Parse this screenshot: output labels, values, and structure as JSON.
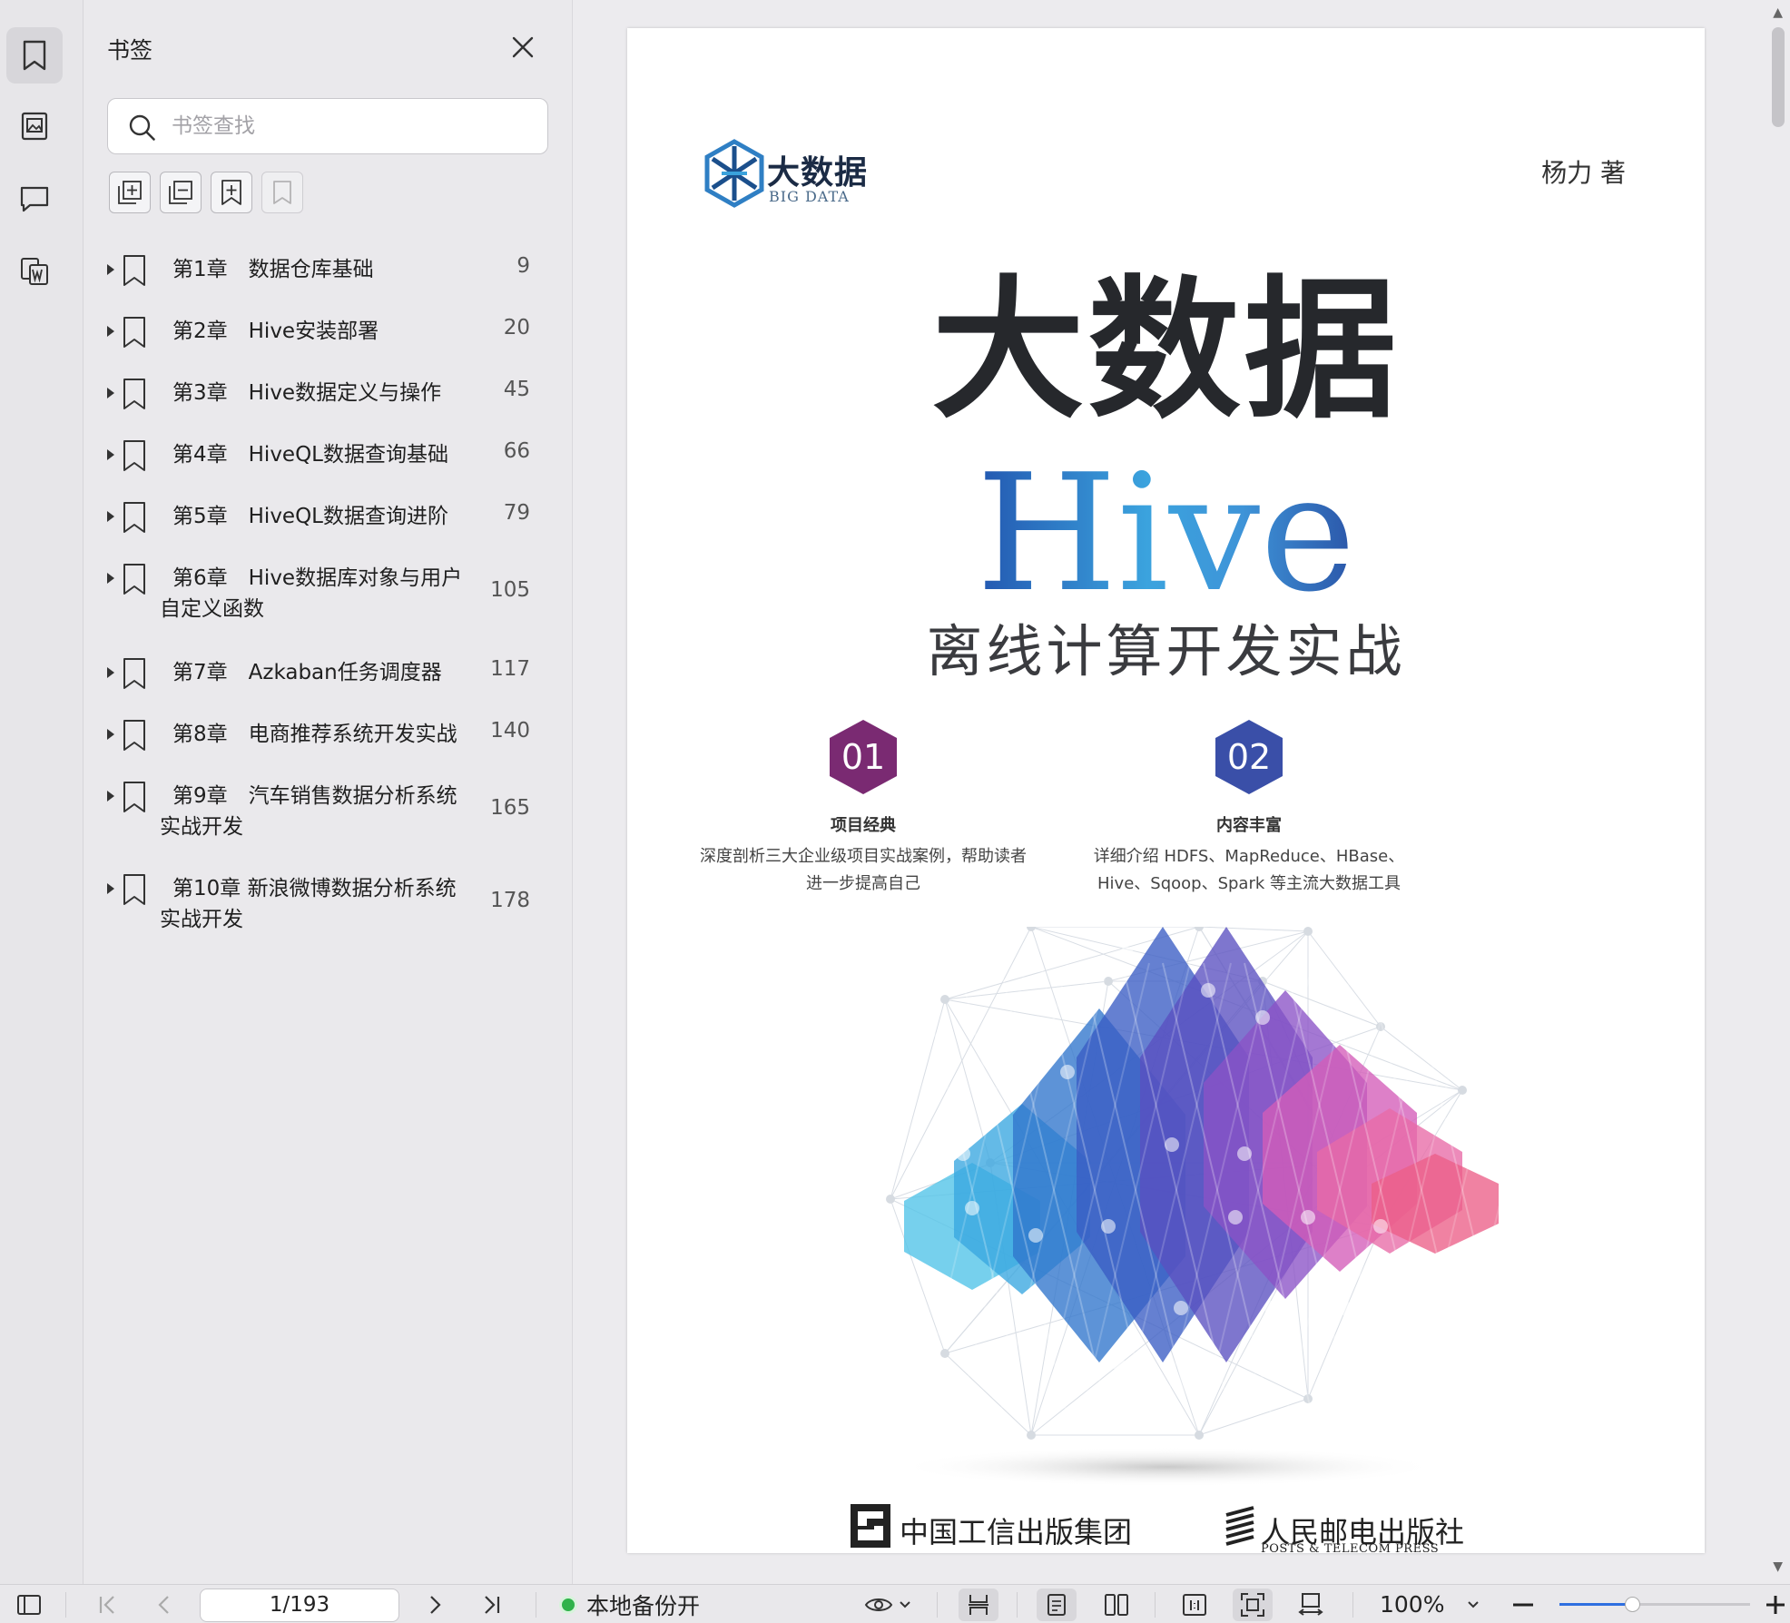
{
  "panel": {
    "title": "书签",
    "search_placeholder": "书签查找"
  },
  "bookmarks": [
    {
      "label": "第1章　数据仓库基础",
      "page": "9"
    },
    {
      "label": "第2章　Hive安装部署",
      "page": "20"
    },
    {
      "label": "第3章　Hive数据定义与操作",
      "page": "45"
    },
    {
      "label": "第4章　HiveQL数据查询基础",
      "page": "66"
    },
    {
      "label": "第5章　HiveQL数据查询进阶",
      "page": "79"
    },
    {
      "label": "第6章　Hive数据库对象与用户自定义函数",
      "page": "105"
    },
    {
      "label": "第7章　Azkaban任务调度器",
      "page": "117"
    },
    {
      "label": "第8章　电商推荐系统开发实战",
      "page": "140"
    },
    {
      "label": "第9章　汽车销售数据分析系统实战开发",
      "page": "165"
    },
    {
      "label": "第10章 新浪微博数据分析系统实战开发",
      "page": "178"
    }
  ],
  "cover": {
    "logo_text": "大数据",
    "logo_sub": "BIG DATA",
    "author": "杨力 著",
    "title": "大数据",
    "hive": "Hive",
    "subtitle": "离线计算开发实战",
    "features": [
      {
        "num": "01",
        "title": "项目经典",
        "desc": "深度剖析三大企业级项目实战案例，帮助读者\n进一步提高自己",
        "color": "#7a2a72"
      },
      {
        "num": "02",
        "title": "内容丰富",
        "desc": "详细介绍 HDFS、MapReduce、HBase、\nHive、Sqoop、Spark 等主流大数据工具",
        "color": "#3a4fa8"
      }
    ],
    "publisher1": "中国工信出版集团",
    "publisher2": "人民邮电出版社",
    "publisher2_sub": "POSTS & TELECOM PRESS"
  },
  "statusbar": {
    "page_indicator": "1/193",
    "backup_label": "本地备份开",
    "zoom": "100%",
    "zoom_fraction": 0.38
  },
  "colors": {
    "accent": "#2f6fe0",
    "backup_green": "#2fb24a"
  }
}
